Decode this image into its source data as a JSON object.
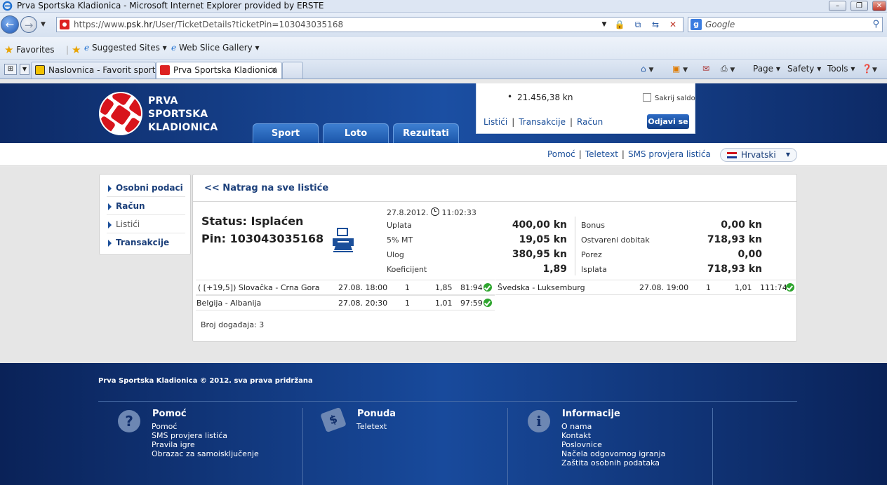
{
  "browser": {
    "window_title": "Prva Sportska Kladionica - Microsoft Internet Explorer provided by ERSTE",
    "url_prefix": "https://www.",
    "url_domain": "psk.hr",
    "url_path": "/User/TicketDetails?ticketPin=103043035168",
    "search_placeholder": "Google",
    "favorites_label": "Favorites",
    "suggested_sites": "Suggested Sites",
    "web_slice_gallery": "Web Slice Gallery",
    "tabs": [
      {
        "label": "Naslovnica - Favorit sports..."
      },
      {
        "label": "Prva Sportska Kladionica"
      }
    ],
    "tools": {
      "page": "Page",
      "safety": "Safety",
      "tools": "Tools"
    }
  },
  "site": {
    "logo_lines": [
      "PRVA",
      "SPORTSKA",
      "KLADIONICA"
    ],
    "nav": [
      "Sport",
      "Loto",
      "Rezultati"
    ],
    "account": {
      "balance": "21.456,38 kn",
      "hide_balance": "Sakrij saldo",
      "links": [
        "Listići",
        "Transakcije",
        "Račun"
      ],
      "logout": "Odjavi se"
    },
    "sub_links": [
      "Pomoć",
      "Teletext",
      "SMS provjera listića"
    ],
    "language": "Hrvatski"
  },
  "sidebar": {
    "items": [
      {
        "label": "Osobni podaci"
      },
      {
        "label": "Račun"
      },
      {
        "label": "Listići"
      },
      {
        "label": "Transakcije"
      }
    ]
  },
  "ticket": {
    "back_link": "<< Natrag na sve listiće",
    "status": "Status: Isplaćen",
    "pin": "Pin: 103043035168",
    "date": "27.8.2012.",
    "time": "11:02:33",
    "left": [
      {
        "label": "Uplata",
        "value": "400,00 kn"
      },
      {
        "label": "5% MT",
        "value": "19,05 kn"
      },
      {
        "label": "Ulog",
        "value": "380,95 kn"
      },
      {
        "label": "Koeficijent",
        "value": "1,89"
      }
    ],
    "right": [
      {
        "label": "Bonus",
        "value": "0,00 kn"
      },
      {
        "label": "Ostvareni dobitak",
        "value": "718,93 kn"
      },
      {
        "label": "Porez",
        "value": "0,00"
      },
      {
        "label": "Isplata",
        "value": "718,93 kn"
      }
    ],
    "events": [
      {
        "match": "( [+19,5]) Slovačka - Crna Gora",
        "date": "27.08. 18:00",
        "tip": "1",
        "odds": "1,85",
        "result": "81:94"
      },
      {
        "match": "Švedska - Luksemburg",
        "date": "27.08. 19:00",
        "tip": "1",
        "odds": "1,01",
        "result": "111:74"
      },
      {
        "match": "Belgija - Albanija",
        "date": "27.08. 20:30",
        "tip": "1",
        "odds": "1,01",
        "result": "97:59"
      }
    ],
    "event_count": "Broj događaja: 3"
  },
  "footer": {
    "copyright": "Prva Sportska Kladionica © 2012. sva prava pridržana",
    "columns": [
      {
        "title": "Pomoć",
        "icon": "question-icon",
        "links": [
          "Pomoć",
          "SMS provjera listića",
          "Pravila igre",
          "Obrazac za samoisključenje"
        ]
      },
      {
        "title": "Ponuda",
        "icon": "tag-icon",
        "links": [
          "Teletext"
        ]
      },
      {
        "title": "Informacije",
        "icon": "info-icon",
        "links": [
          "O nama",
          "Kontakt",
          "Poslovnice",
          "Načela odgovornog igranja",
          "Zaštita osobnih podataka"
        ]
      }
    ]
  },
  "colors": {
    "brand_blue": "#1b4fa3",
    "logo_red": "#d8141c",
    "ok_green": "#2ea52e"
  }
}
